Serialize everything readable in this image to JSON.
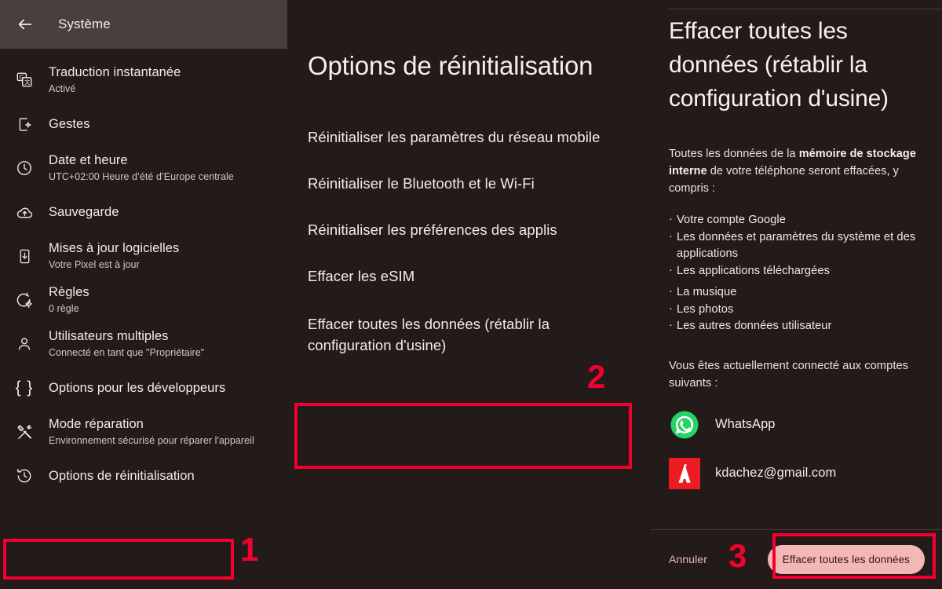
{
  "sidebar": {
    "title": "Système",
    "back_icon": "back-arrow-icon",
    "items": [
      {
        "icon": "instant-translate-icon",
        "label": "Traduction instantanée",
        "sub": "Activé"
      },
      {
        "icon": "gestures-phone-icon",
        "label": "Gestes",
        "sub": ""
      },
      {
        "icon": "clock-icon",
        "label": "Date et heure",
        "sub": "UTC+02:00 Heure d’été d’Europe centrale"
      },
      {
        "icon": "cloud-backup-icon",
        "label": "Sauvegarde",
        "sub": ""
      },
      {
        "icon": "system-update-icon",
        "label": "Mises à jour logicielles",
        "sub": "Votre Pixel est à jour"
      },
      {
        "icon": "rules-gear-icon",
        "label": "Règles",
        "sub": "0 règle"
      },
      {
        "icon": "person-icon",
        "label": "Utilisateurs multiples",
        "sub": "Connecté en tant que \"Propriétaire\""
      },
      {
        "icon": "braces-icon",
        "label": "Options pour les développeurs",
        "sub": ""
      },
      {
        "icon": "repair-tools-icon",
        "label": "Mode réparation",
        "sub": "Environnement sécurisé pour réparer l'appareil"
      },
      {
        "icon": "history-reset-icon",
        "label": "Options de réinitialisation",
        "sub": ""
      }
    ]
  },
  "middle": {
    "title": "Options de réinitialisation",
    "options": [
      "Réinitialiser les paramètres du réseau mobile",
      "Réinitialiser le Bluetooth et le Wi-Fi",
      "Réinitialiser les préférences des applis",
      "Effacer les eSIM",
      "Effacer toutes les données (rétablir la configuration d'usine)"
    ]
  },
  "right": {
    "title": "Effacer toutes les données (rétablir la configuration d'usine)",
    "intro_before": "Toutes les données de la ",
    "intro_bold": "mémoire de stockage interne",
    "intro_after": " de votre téléphone seront effacées, y compris :",
    "bullets": [
      "Votre compte Google",
      "Les données et paramètres du système et des applications",
      "Les applications téléchargées",
      "La musique",
      "Les photos",
      "Les autres données utilisateur"
    ],
    "accounts_lead": "Vous êtes actuellement connecté aux comptes suivants :",
    "accounts": [
      {
        "icon": "whatsapp-logo-icon",
        "name": "WhatsApp",
        "color": "#25d366"
      },
      {
        "icon": "adobe-logo-icon",
        "name": "kdachez@gmail.com",
        "color": "#ed1c24"
      }
    ],
    "cancel_label": "Annuler",
    "erase_label": "Effacer toutes les données"
  },
  "annotations": {
    "color": "#f4002e",
    "steps": [
      {
        "number": "1"
      },
      {
        "number": "2"
      },
      {
        "number": "3"
      }
    ]
  }
}
